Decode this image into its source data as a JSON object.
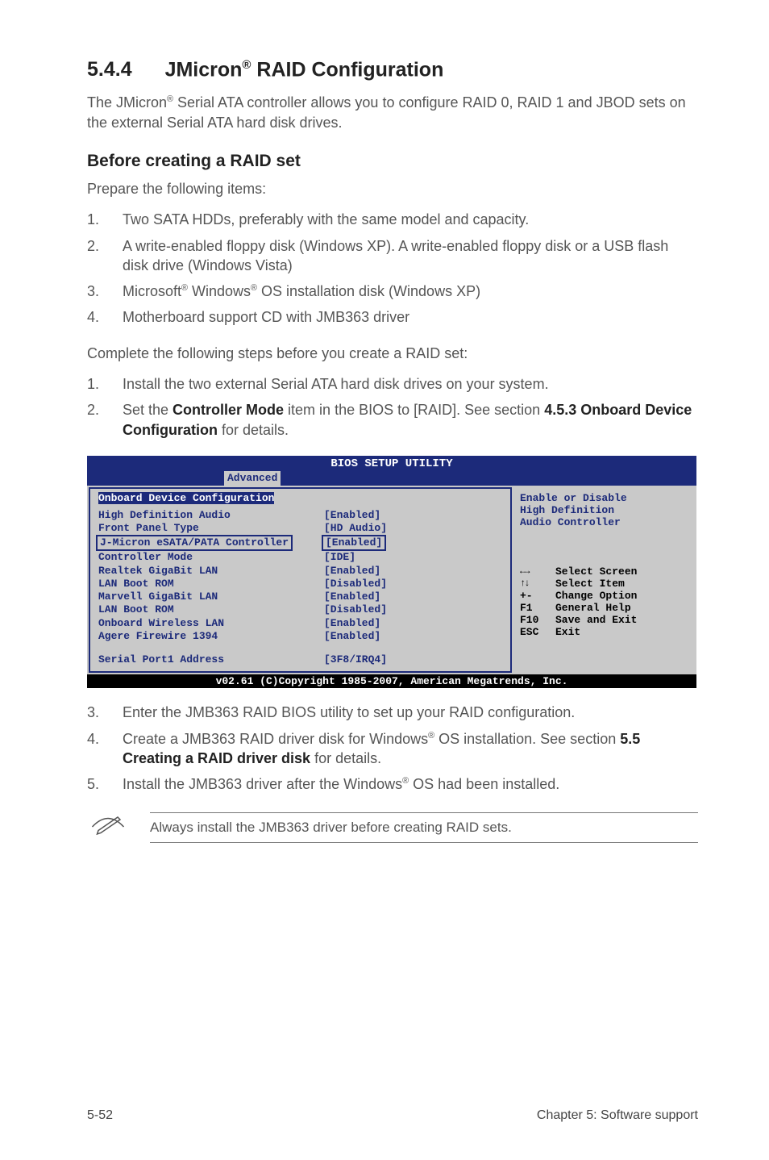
{
  "heading": {
    "number": "5.4.4",
    "before_sup": "JMicron",
    "sup": "®",
    "after_sup": " RAID Configuration"
  },
  "intro": {
    "pre": "The JMicron",
    "sup": "®",
    "post": " Serial ATA controller allows you to configure RAID 0, RAID 1 and JBOD sets on the external Serial ATA hard disk drives."
  },
  "before_head": "Before creating a RAID set",
  "prepare": "Prepare the following items:",
  "prep_items": [
    "Two SATA HDDs, preferably with the same model and capacity.",
    "A write-enabled floppy disk (Windows XP). A write-enabled floppy disk or a USB flash disk drive (Windows Vista)",
    "",
    "Motherboard support CD with JMB363 driver"
  ],
  "item3": {
    "a": "Microsoft",
    "b": " Windows",
    "c": " OS installation disk (Windows XP)",
    "sup": "®"
  },
  "complete_intro": "Complete the following steps before you create a RAID set:",
  "complete_items": [
    "Install the two external Serial ATA hard disk drives on your system."
  ],
  "complete2": {
    "pre": "Set the ",
    "b1": "Controller Mode",
    "mid": " item in the BIOS to [RAID]. See section ",
    "b2": "4.5.3 Onboard Device Configuration",
    "post": " for details."
  },
  "bios": {
    "title": "BIOS SETUP UTILITY",
    "tab": "Advanced",
    "group": "Onboard Device Configuration",
    "rows": [
      {
        "k": "High Definition Audio",
        "v": "[Enabled]"
      },
      {
        "k": " Front Panel Type",
        "v": "[HD Audio]"
      },
      {
        "k": "J-Micron eSATA/PATA Controller",
        "v": "[Enabled]",
        "boxed": true
      },
      {
        "k": " Controller Mode",
        "v": "[IDE]"
      },
      {
        "k": "Realtek GigaBit LAN",
        "v": "[Enabled]"
      },
      {
        "k": " LAN Boot ROM",
        "v": "[Disabled]"
      },
      {
        "k": "Marvell GigaBit LAN",
        "v": "[Enabled]"
      },
      {
        "k": " LAN Boot ROM",
        "v": "[Disabled]"
      },
      {
        "k": "Onboard Wireless LAN",
        "v": "[Enabled]"
      },
      {
        "k": "Agere Firewire 1394",
        "v": "[Enabled]"
      },
      {
        "k": "",
        "v": ""
      },
      {
        "k": "Serial Port1 Address",
        "v": "[3F8/IRQ4]"
      }
    ],
    "help": [
      "Enable or Disable",
      "High Definition",
      "Audio Controller"
    ],
    "nav": [
      {
        "sym": "←→",
        "label": "Select Screen"
      },
      {
        "sym": "↑↓",
        "label": "Select Item"
      },
      {
        "sym": "+-",
        "label": "Change Option"
      },
      {
        "sym": "F1",
        "label": "General Help"
      },
      {
        "sym": "F10",
        "label": "Save and Exit"
      },
      {
        "sym": "ESC",
        "label": "Exit"
      }
    ],
    "foot": "v02.61 (C)Copyright 1985-2007, American Megatrends, Inc."
  },
  "after_items": {
    "i3": "Enter the JMB363 RAID BIOS utility to set up your RAID configuration.",
    "i4pre": "Create a JMB363 RAID driver disk for Windows",
    "sup": "®",
    "i4mid": " OS installation. See section ",
    "i4bold": "5.5 Creating a RAID driver disk",
    "i4post": " for details.",
    "i5pre": "Install the JMB363 driver after the Windows",
    "i5post": " OS had been installed."
  },
  "callout": "Always install the JMB363 driver before creating RAID sets.",
  "footer": {
    "left": "5-52",
    "right": "Chapter 5: Software support"
  }
}
